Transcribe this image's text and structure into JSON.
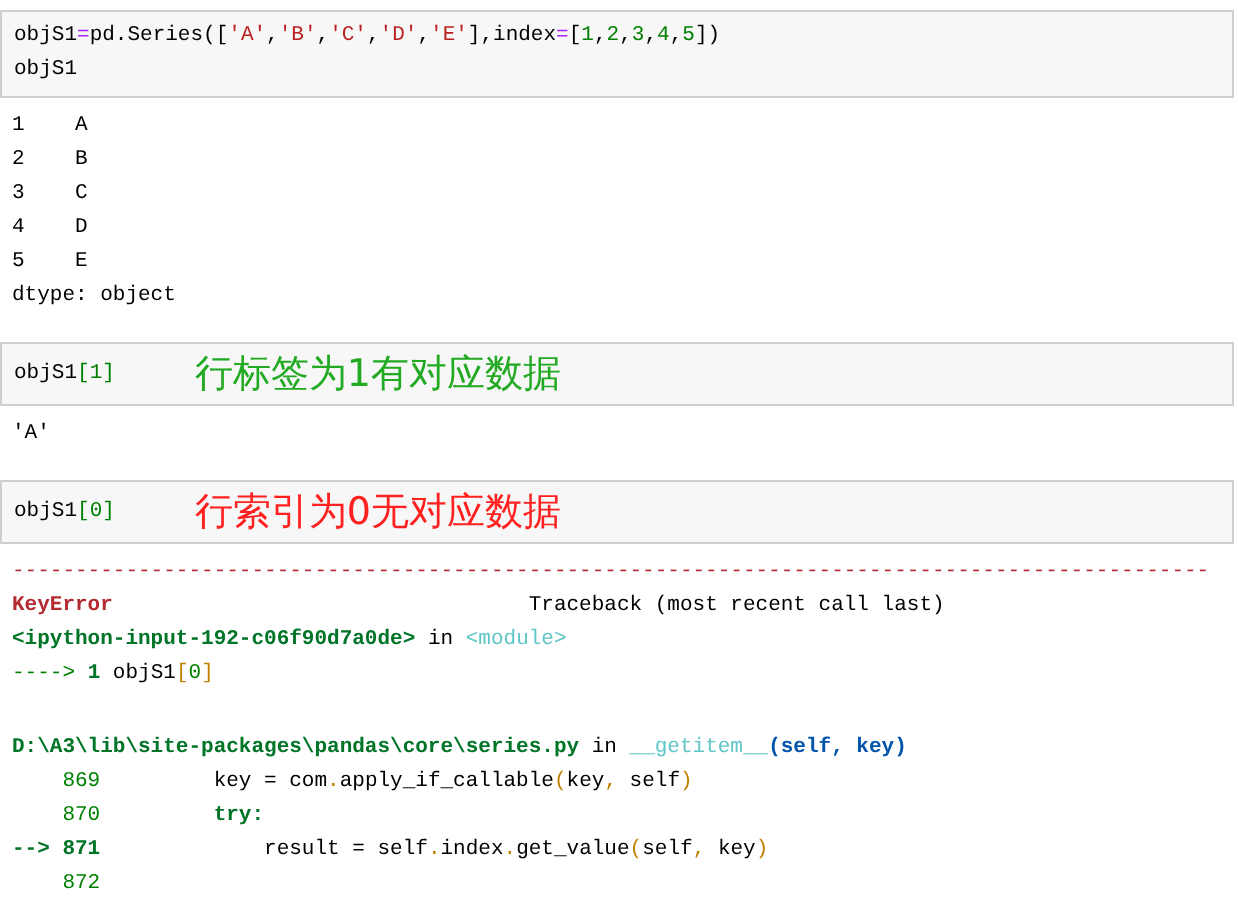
{
  "cells": [
    {
      "kind": "input",
      "lines": [
        [
          {
            "text": "objS1",
            "kind": "plain"
          },
          {
            "text": "=",
            "kind": "op"
          },
          {
            "text": "pd.Series([",
            "kind": "plain"
          },
          {
            "text": "'A'",
            "kind": "str"
          },
          {
            "text": ",",
            "kind": "plain"
          },
          {
            "text": "'B'",
            "kind": "str"
          },
          {
            "text": ",",
            "kind": "plain"
          },
          {
            "text": "'C'",
            "kind": "str"
          },
          {
            "text": ",",
            "kind": "plain"
          },
          {
            "text": "'D'",
            "kind": "str"
          },
          {
            "text": ",",
            "kind": "plain"
          },
          {
            "text": "'E'",
            "kind": "str"
          },
          {
            "text": "],index",
            "kind": "plain"
          },
          {
            "text": "=",
            "kind": "op"
          },
          {
            "text": "[",
            "kind": "plain"
          },
          {
            "text": "1",
            "kind": "num"
          },
          {
            "text": ",",
            "kind": "plain"
          },
          {
            "text": "2",
            "kind": "num"
          },
          {
            "text": ",",
            "kind": "plain"
          },
          {
            "text": "3",
            "kind": "num"
          },
          {
            "text": ",",
            "kind": "plain"
          },
          {
            "text": "4",
            "kind": "num"
          },
          {
            "text": ",",
            "kind": "plain"
          },
          {
            "text": "5",
            "kind": "num"
          },
          {
            "text": "])",
            "kind": "plain"
          }
        ],
        [
          {
            "text": "objS1",
            "kind": "plain"
          }
        ]
      ]
    },
    {
      "kind": "output",
      "lines": [
        [
          {
            "text": "1    A",
            "kind": "plain"
          }
        ],
        [
          {
            "text": "2    B",
            "kind": "plain"
          }
        ],
        [
          {
            "text": "3    C",
            "kind": "plain"
          }
        ],
        [
          {
            "text": "4    D",
            "kind": "plain"
          }
        ],
        [
          {
            "text": "5    E",
            "kind": "plain"
          }
        ],
        [
          {
            "text": "dtype: object",
            "kind": "plain"
          }
        ]
      ]
    },
    {
      "kind": "input",
      "lines": [
        [
          {
            "text": "objS1",
            "kind": "plain"
          },
          {
            "text": "[1]",
            "kind": "num"
          }
        ]
      ],
      "annotation": {
        "text": "行标签为1有对应数据",
        "kind": "ok"
      }
    },
    {
      "kind": "output",
      "lines": [
        [
          {
            "text": "'A'",
            "kind": "plain"
          }
        ]
      ]
    },
    {
      "kind": "input",
      "lines": [
        [
          {
            "text": "objS1",
            "kind": "plain"
          },
          {
            "text": "[0]",
            "kind": "num"
          }
        ]
      ],
      "annotation": {
        "text": "行索引为0无对应数据",
        "kind": "error"
      }
    },
    {
      "kind": "output",
      "lines": [
        [
          {
            "text": "-----------------------------------------------------------------------------------------------",
            "kind": "err"
          }
        ],
        [
          {
            "text": "KeyError",
            "kind": "errbold"
          },
          {
            "text": "                                 Traceback (most recent call last)",
            "kind": "plain"
          }
        ],
        [
          {
            "text": "<ipython-input-192-c06f90d7a0de>",
            "kind": "path"
          },
          {
            "text": " in ",
            "kind": "plain"
          },
          {
            "text": "<module>",
            "kind": "func"
          }
        ],
        [
          {
            "text": "---->",
            "kind": "num"
          },
          {
            "text": " 1",
            "kind": "path"
          },
          {
            "text": " objS1",
            "kind": "plain"
          },
          {
            "text": "[",
            "kind": "punct"
          },
          {
            "text": "0",
            "kind": "num"
          },
          {
            "text": "]",
            "kind": "punct"
          }
        ]
      ]
    },
    {
      "kind": "output",
      "lines": [
        [
          {
            "text": "D:\\A3\\lib\\site-packages\\pandas\\core\\series.py",
            "kind": "path"
          },
          {
            "text": " in ",
            "kind": "plain"
          },
          {
            "text": "__getitem__",
            "kind": "func"
          },
          {
            "text": "(self, key)",
            "kind": "args"
          }
        ],
        [
          {
            "text": "    869",
            "kind": "num"
          },
          {
            "text": "         key = com",
            "kind": "plain"
          },
          {
            "text": ".",
            "kind": "punct"
          },
          {
            "text": "apply_if_callable",
            "kind": "plain"
          },
          {
            "text": "(",
            "kind": "punct"
          },
          {
            "text": "key",
            "kind": "plain"
          },
          {
            "text": ",",
            "kind": "punct"
          },
          {
            "text": " self",
            "kind": "plain"
          },
          {
            "text": ")",
            "kind": "punct"
          }
        ],
        [
          {
            "text": "    870",
            "kind": "num"
          },
          {
            "text": "         try:",
            "kind": "path"
          }
        ],
        [
          {
            "text": "--> 871",
            "kind": "path"
          },
          {
            "text": "             result = self",
            "kind": "plain"
          },
          {
            "text": ".",
            "kind": "punct"
          },
          {
            "text": "index",
            "kind": "plain"
          },
          {
            "text": ".",
            "kind": "punct"
          },
          {
            "text": "get_value",
            "kind": "plain"
          },
          {
            "text": "(",
            "kind": "punct"
          },
          {
            "text": "self",
            "kind": "plain"
          },
          {
            "text": ",",
            "kind": "punct"
          },
          {
            "text": " key",
            "kind": "plain"
          },
          {
            "text": ")",
            "kind": "punct"
          }
        ],
        [
          {
            "text": "    872",
            "kind": "num"
          }
        ]
      ]
    }
  ]
}
